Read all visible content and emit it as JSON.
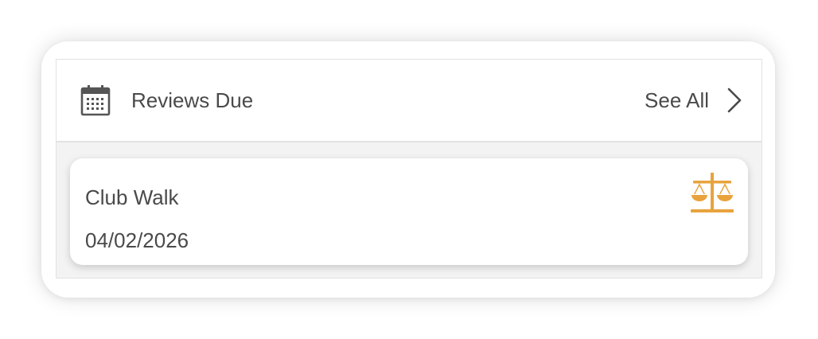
{
  "widget": {
    "header": {
      "icon": "calendar-icon",
      "title": "Reviews Due",
      "see_all_label": "See All",
      "see_all_icon": "chevron-right-icon"
    },
    "reviews": [
      {
        "title": "Club Walk",
        "date": "04/02/2026",
        "icon": "scale-icon",
        "icon_color": "#E8A33D"
      }
    ]
  },
  "colors": {
    "text": "#4a4a4a",
    "accent": "#E8A33D",
    "panel_background": "#f3f3f3",
    "card_background": "#ffffff"
  }
}
